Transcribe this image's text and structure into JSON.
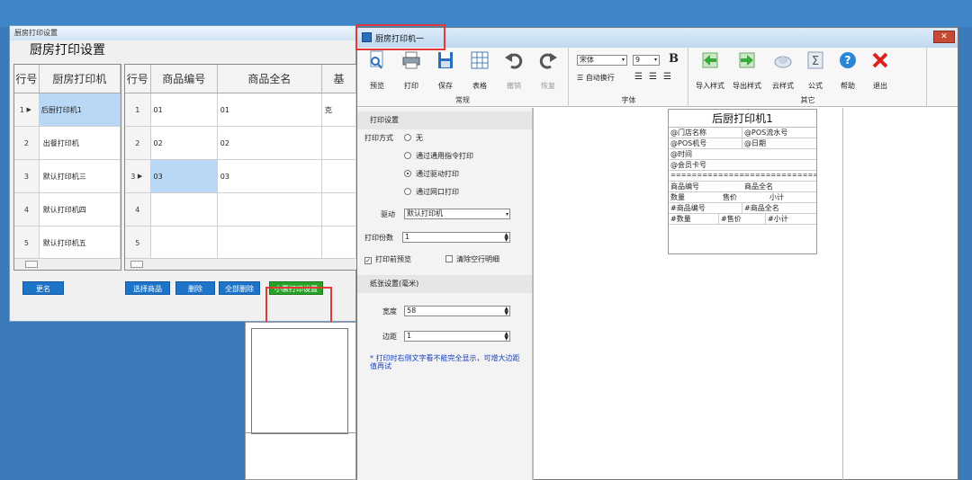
{
  "left_window": {
    "title": "厨房打印设置",
    "heading": "厨房打印设置",
    "printers_grid": {
      "headers": [
        "行号",
        "厨房打印机"
      ],
      "rows": [
        {
          "num": "1",
          "name": "后厨打印机1"
        },
        {
          "num": "2",
          "name": "出餐打印机"
        },
        {
          "num": "3",
          "name": "默认打印机三"
        },
        {
          "num": "4",
          "name": "默认打印机四"
        },
        {
          "num": "5",
          "name": "默认打印机五"
        }
      ]
    },
    "goods_grid": {
      "headers": [
        "行号",
        "商品编号",
        "商品全名",
        "基"
      ],
      "rows": [
        {
          "num": "1",
          "code": "01",
          "name": "01",
          "unit": "克"
        },
        {
          "num": "2",
          "code": "02",
          "name": "02",
          "unit": ""
        },
        {
          "num": "3",
          "code": "03",
          "name": "03",
          "unit": ""
        },
        {
          "num": "4",
          "code": "",
          "name": "",
          "unit": ""
        },
        {
          "num": "5",
          "code": "",
          "name": "",
          "unit": ""
        }
      ]
    },
    "buttons": {
      "rename": "更名",
      "select_goods": "选择商品",
      "delete": "删除",
      "delete_all": "全部删除",
      "receipt_settings": "小票打印设置"
    }
  },
  "right_window": {
    "title": "厨房打印机一",
    "close": "✕",
    "ribbon": {
      "group_normal": "常规",
      "group_font": "字体",
      "group_other": "其它",
      "preview": "预览",
      "print": "打印",
      "save": "保存",
      "table": "表格",
      "undo": "撤销",
      "redo": "恢复",
      "font_name": "宋体",
      "font_size": "9",
      "bold": "B",
      "auto_wrap": "自动换行",
      "import_style": "导入样式",
      "export_style": "导出样式",
      "cloud_style": "云样式",
      "formula": "公式",
      "help": "帮助",
      "exit": "退出"
    },
    "settings": {
      "print_section": "打印设置",
      "print_mode_label": "打印方式",
      "modes": [
        "无",
        "通过通用指令打印",
        "通过驱动打印",
        "通过网口打印"
      ],
      "selected_mode_index": 2,
      "driver_label": "驱动",
      "driver_value": "默认打印机",
      "copies_label": "打印份数",
      "copies_value": "1",
      "preview_before_print": "打印前预览",
      "preview_before_print_checked": true,
      "remove_blank": "清除空行明细",
      "remove_blank_checked": false,
      "paper_section": "纸张设置(毫米)",
      "width_label": "宽度",
      "width_value": "58",
      "margin_label": "边距",
      "margin_value": "1",
      "note": "* 打印时右侧文字看不能完全显示，可增大边距值再试"
    },
    "receipt": {
      "title": "后厨打印机1",
      "rows": [
        [
          "@门店名称",
          "@POS流水号"
        ],
        [
          "@POS机号",
          "@日期"
        ],
        [
          "@时间"
        ],
        [
          "@会员卡号"
        ],
        [
          "=================================="
        ],
        [
          "商品编号",
          "商品全名"
        ],
        [
          "数量",
          "售价",
          "小计"
        ],
        [
          "#商品编号",
          "#商品全名"
        ],
        [
          "#数量",
          "#售价",
          "#小计"
        ]
      ]
    }
  },
  "colors": {
    "desktop": "#3a7ab8",
    "highlight_box": "#e53935",
    "button_blue": "#1e74c8",
    "button_green": "#28a228",
    "selection": "#b9d8f6"
  }
}
